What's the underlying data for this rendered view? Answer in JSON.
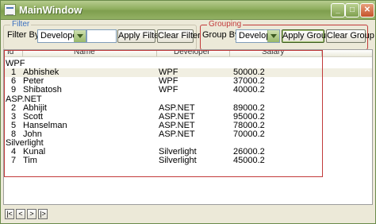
{
  "window": {
    "title": "MainWindow"
  },
  "filter": {
    "group_title": "Filter",
    "label": "Filter By :",
    "combo_value": "Developer",
    "text_value": "",
    "apply_label": "Apply Filter",
    "clear_label": "Clear Filter"
  },
  "grouping": {
    "group_title": "Grouping",
    "label": "Group By :",
    "combo_value": "Developer",
    "apply_label": "Apply Group",
    "clear_label": "Clear Group"
  },
  "grid": {
    "columns": [
      "Id",
      "Name",
      "Developer",
      "Salary"
    ],
    "groups": [
      {
        "name": "WPF",
        "rows": [
          {
            "id": "1",
            "name": "Abhishek",
            "developer": "WPF",
            "salary": "50000.2"
          },
          {
            "id": "6",
            "name": "Peter",
            "developer": "WPF",
            "salary": "37000.2"
          },
          {
            "id": "9",
            "name": "Shibatosh",
            "developer": "WPF",
            "salary": "40000.2"
          }
        ]
      },
      {
        "name": "ASP.NET",
        "rows": [
          {
            "id": "2",
            "name": "Abhijit",
            "developer": "ASP.NET",
            "salary": "89000.2"
          },
          {
            "id": "3",
            "name": "Scott",
            "developer": "ASP.NET",
            "salary": "95000.2"
          },
          {
            "id": "5",
            "name": "Hanselman",
            "developer": "ASP.NET",
            "salary": "78000.2"
          },
          {
            "id": "8",
            "name": "John",
            "developer": "ASP.NET",
            "salary": "70000.2"
          }
        ]
      },
      {
        "name": "Silverlight",
        "rows": [
          {
            "id": "4",
            "name": "Kunal",
            "developer": "Silverlight",
            "salary": "26000.2"
          },
          {
            "id": "7",
            "name": "Tim",
            "developer": "Silverlight",
            "salary": "45000.2"
          }
        ]
      }
    ]
  },
  "pager": {
    "first": "|<",
    "prev": "<",
    "next": ">",
    "last": "|>"
  }
}
